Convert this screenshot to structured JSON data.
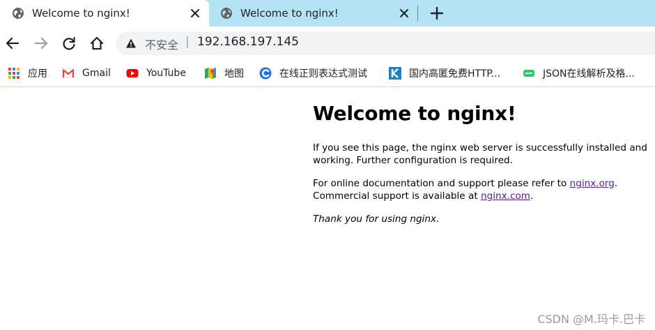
{
  "tabs": [
    {
      "title": "Welcome to nginx!",
      "active": true
    },
    {
      "title": "Welcome to nginx!",
      "active": false
    }
  ],
  "toolbar": {
    "security_label": "不安全",
    "separator": "|",
    "url": "192.168.197.145"
  },
  "bookmarks": [
    {
      "label": "应用",
      "icon": "apps-grid-icon"
    },
    {
      "label": "Gmail",
      "icon": "gmail-icon"
    },
    {
      "label": "YouTube",
      "icon": "youtube-icon"
    },
    {
      "label": "地图",
      "icon": "maps-icon"
    },
    {
      "label": "在线正则表达式测试",
      "icon": "regex-site-icon"
    },
    {
      "label": "国内高匿免费HTTP...",
      "icon": "k-site-icon"
    },
    {
      "label": "JSON在线解析及格...",
      "icon": "json-site-icon"
    }
  ],
  "page": {
    "heading": "Welcome to nginx!",
    "p1": "If you see this page, the nginx web server is successfully installed and working. Further configuration is required.",
    "p2_before": "For online documentation and support please refer to ",
    "p2_link1": "nginx.org",
    "p2_mid": ".\nCommercial support is available at ",
    "p2_link2": "nginx.com",
    "p2_after": ".",
    "p3": "Thank you for using nginx."
  },
  "watermark": "CSDN @M.玛卡.巴卡",
  "colors": {
    "tabstrip": "#b6e3f4",
    "link": "#551a8b"
  }
}
